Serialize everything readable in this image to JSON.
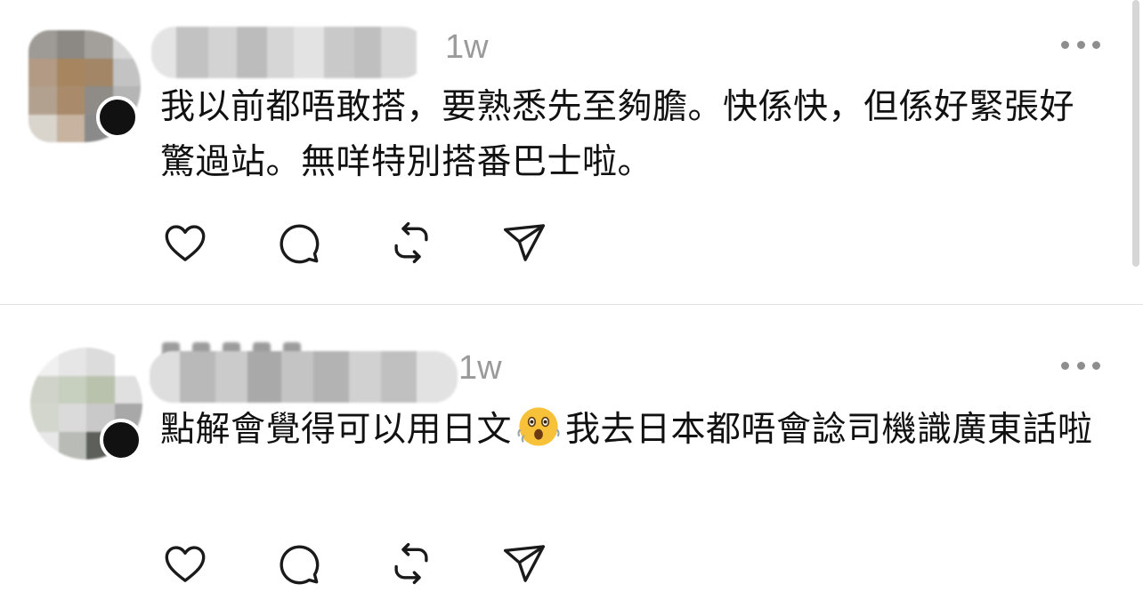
{
  "posts": [
    {
      "timestamp": "1w",
      "text": "我以前都唔敢搭，要熟悉先至夠膽。快係快，但係好緊張好驚過站。無咩特別搭番巴士啦。",
      "actions": [
        "like-icon",
        "reply-icon",
        "repost-icon",
        "share-icon"
      ]
    },
    {
      "timestamp": "1w",
      "text_before_emoji": "點解會覺得可以用日文",
      "emoji": "astonished-face-emoji",
      "text_after_emoji": "我去日本都唔會諗司機識廣東話啦",
      "actions": [
        "like-icon",
        "reply-icon",
        "repost-icon",
        "share-icon"
      ]
    }
  ],
  "colors": {
    "text": "#111111",
    "timestamp": "#9a9a9a",
    "icon": "#1a1a1a",
    "divider": "#e2e2e2"
  }
}
